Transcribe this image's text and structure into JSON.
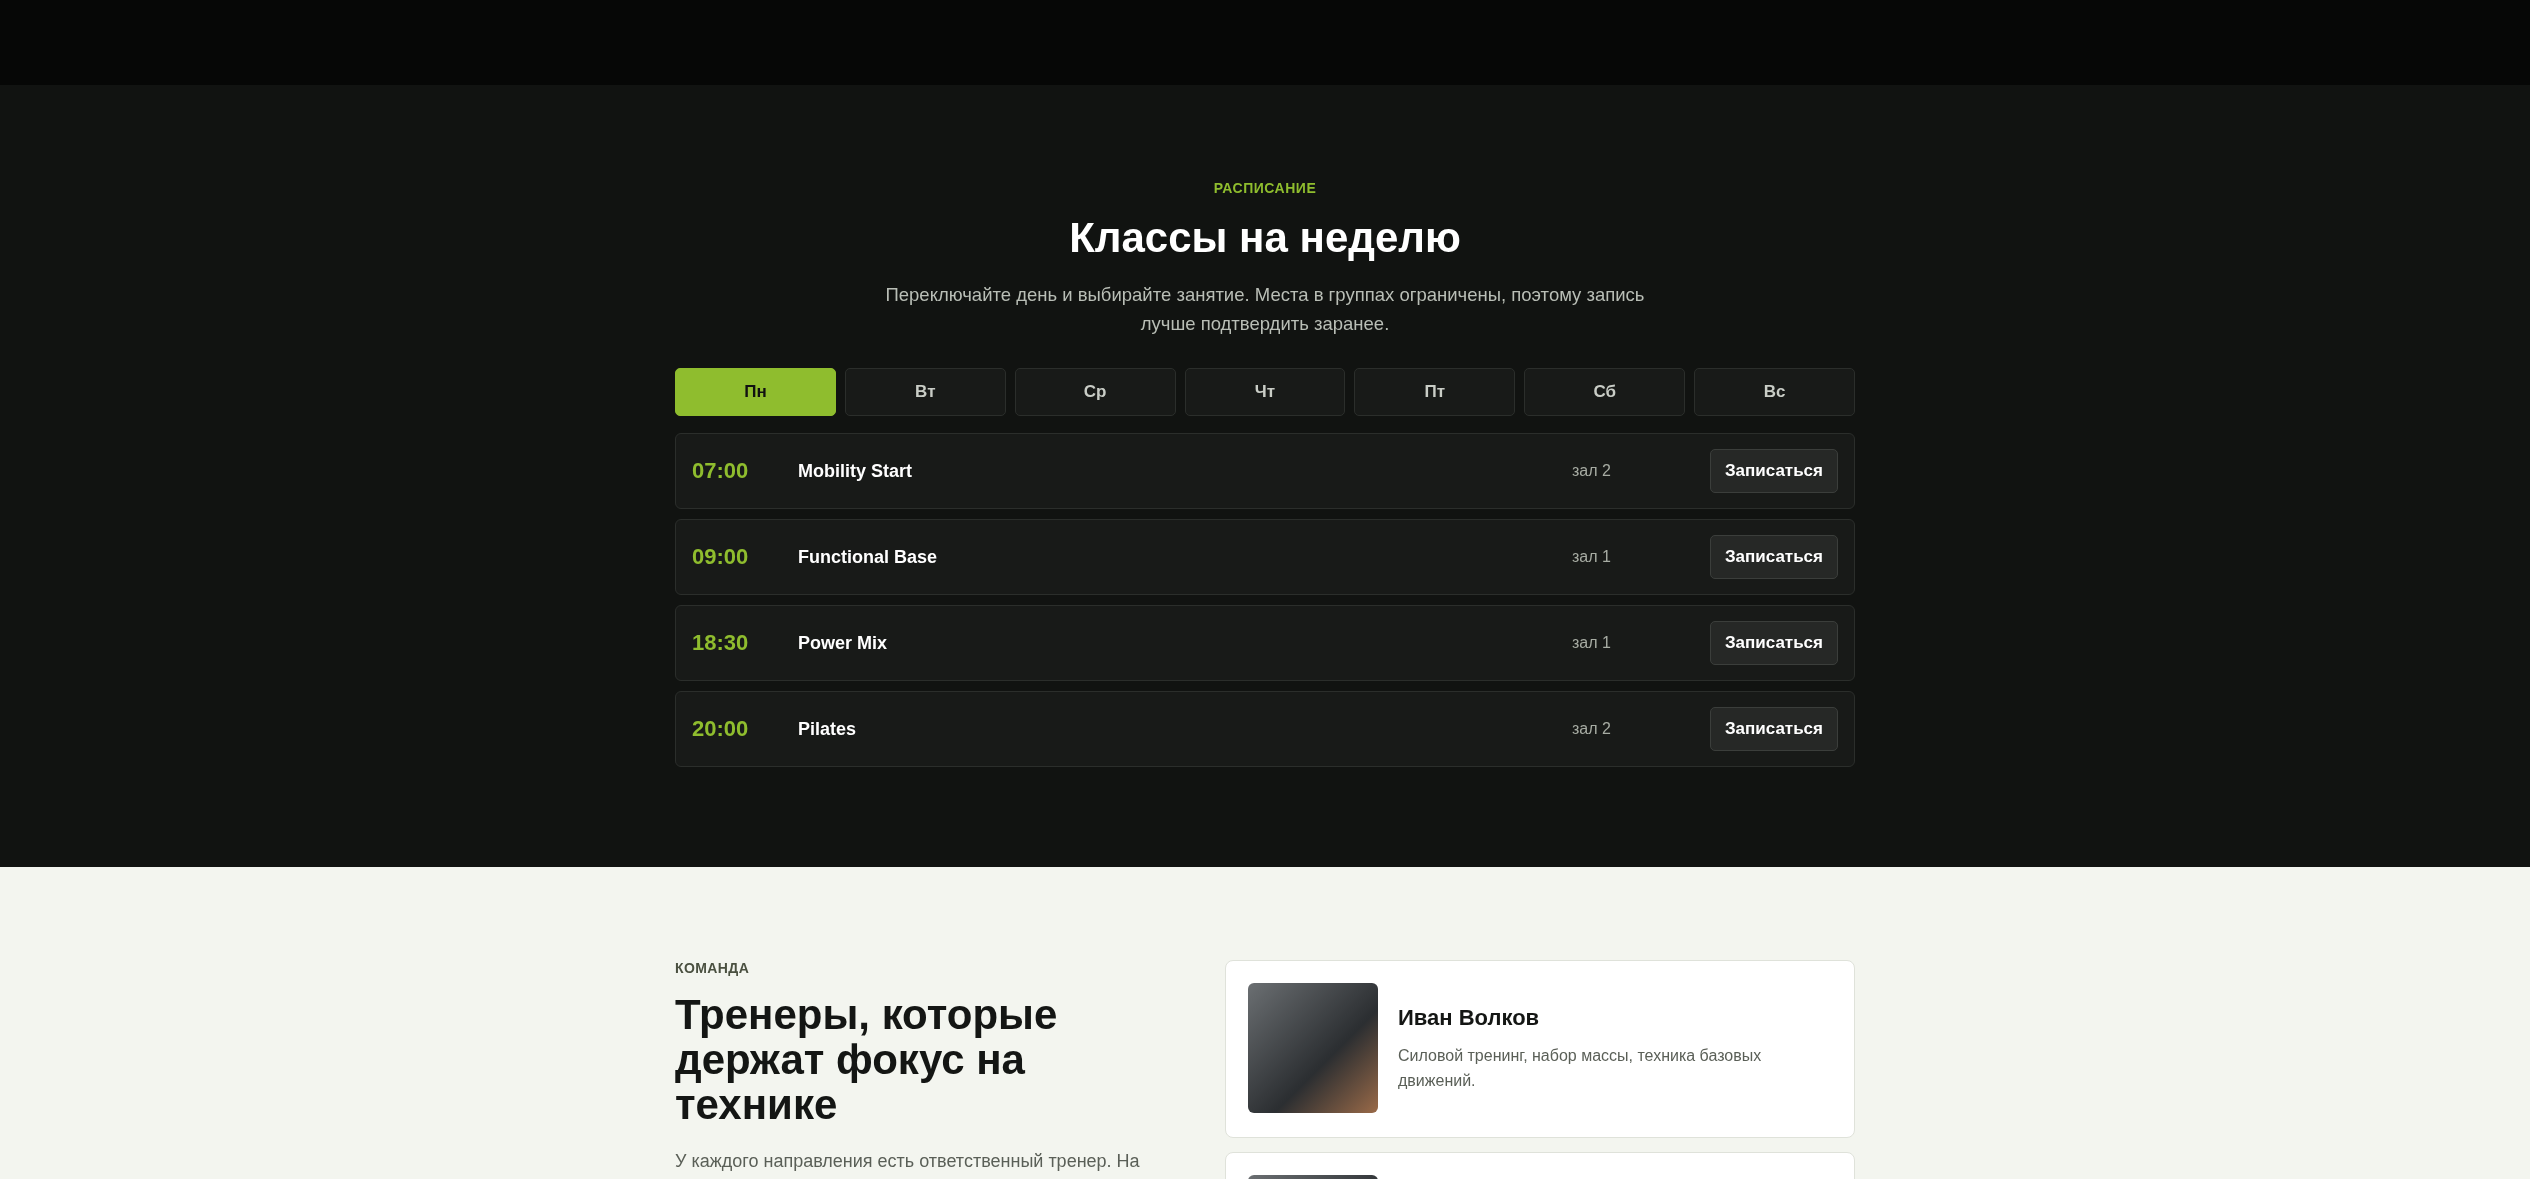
{
  "schedule": {
    "eyebrow": "РАСПИСАНИЕ",
    "title": "Классы на неделю",
    "subtitle": "Переключайте день и выбирайте занятие. Места в группах ограничены, поэтому запись лучше подтвердить заранее.",
    "days": [
      {
        "label": "Пн",
        "selected": true
      },
      {
        "label": "Вт",
        "selected": false
      },
      {
        "label": "Ср",
        "selected": false
      },
      {
        "label": "Чт",
        "selected": false
      },
      {
        "label": "Пт",
        "selected": false
      },
      {
        "label": "Сб",
        "selected": false
      },
      {
        "label": "Вс",
        "selected": false
      }
    ],
    "classes": [
      {
        "time": "07:00",
        "name": "Mobility Start",
        "room": "зал 2",
        "button": "Записаться"
      },
      {
        "time": "09:00",
        "name": "Functional Base",
        "room": "зал 1",
        "button": "Записаться"
      },
      {
        "time": "18:30",
        "name": "Power Mix",
        "room": "зал 1",
        "button": "Записаться"
      },
      {
        "time": "20:00",
        "name": "Pilates",
        "room": "зал 2",
        "button": "Записаться"
      }
    ]
  },
  "team": {
    "eyebrow": "КОМАНДА",
    "title": "Тренеры, которые держат фокус на технике",
    "intro": "У каждого направления есть ответственный тренер. На",
    "trainers": [
      {
        "name": "Иван Волков",
        "specialty": "Силовой тренинг, набор массы, техника базовых движений."
      }
    ]
  }
}
